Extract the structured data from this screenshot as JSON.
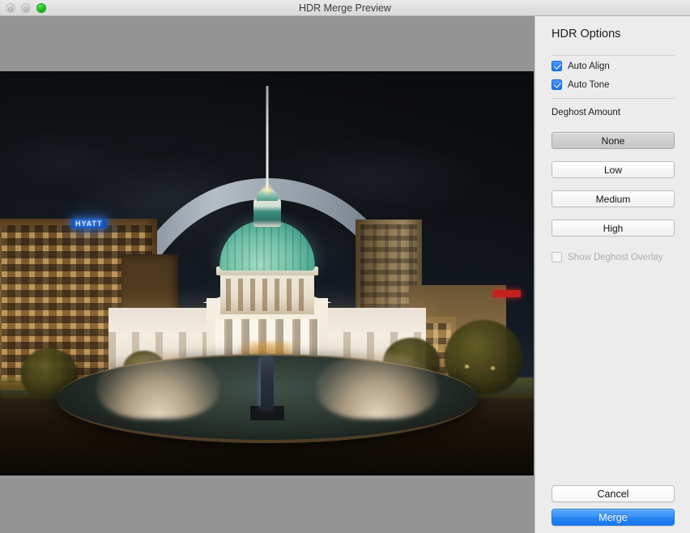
{
  "window": {
    "title": "HDR Merge Preview",
    "controls": [
      {
        "name": "close",
        "glyph": "⊖",
        "state": "disabled"
      },
      {
        "name": "minimize",
        "glyph": "⊖",
        "state": "disabled"
      },
      {
        "name": "zoom",
        "glyph": "⊕",
        "state": "enabled"
      }
    ]
  },
  "panel": {
    "title": "HDR Options",
    "checkboxes": [
      {
        "label": "Auto Align",
        "checked": true,
        "enabled": true
      },
      {
        "label": "Auto Tone",
        "checked": true,
        "enabled": true
      }
    ],
    "deghost": {
      "label": "Deghost Amount",
      "options": [
        "None",
        "Low",
        "Medium",
        "High"
      ],
      "selected": "None",
      "overlay": {
        "label": "Show Deghost Overlay",
        "checked": false,
        "enabled": false
      }
    },
    "actions": {
      "cancel_label": "Cancel",
      "merge_label": "Merge"
    }
  },
  "preview": {
    "alt": "Night photograph of the St. Louis Old Courthouse framed by the Gateway Arch, with a lit fountain in the foreground",
    "signs": {
      "hyatt": "HYATT"
    }
  },
  "colors": {
    "accent_blue": "#2583f2",
    "checkbox_blue": "#1f72e8",
    "panel_background": "#ececec",
    "canvas_gray": "#949494",
    "titlebar_gray": "#e1e1e1",
    "zoom_green": "#21c921"
  }
}
